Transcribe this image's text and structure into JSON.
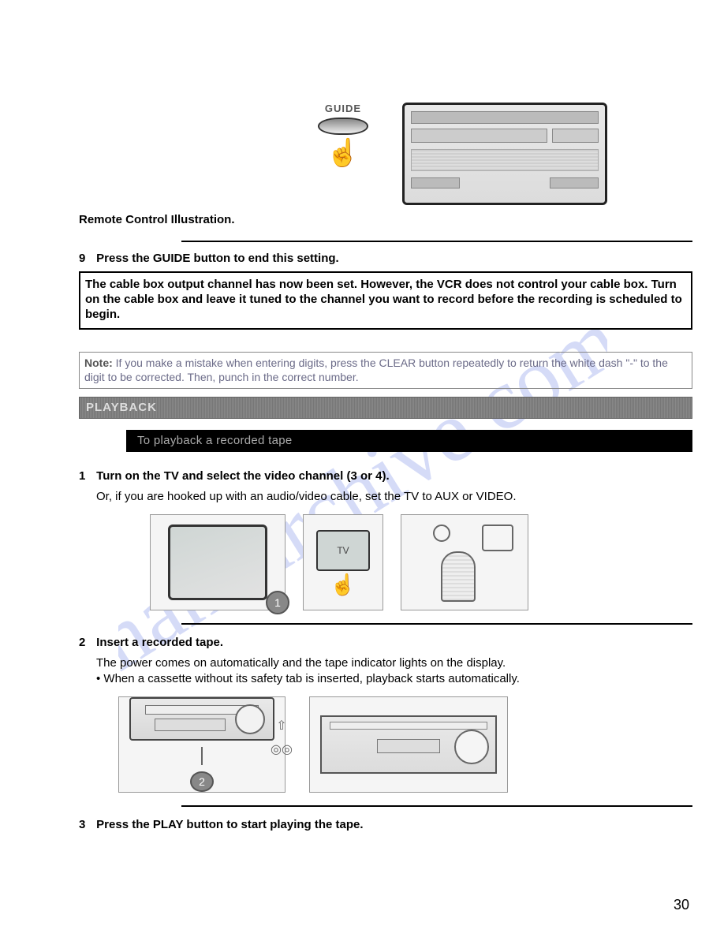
{
  "hero": {
    "guide_label": "GUIDE"
  },
  "captions": {
    "remote": "Remote Control Illustration."
  },
  "steps": {
    "s9": {
      "num": "9",
      "text": "Press the GUIDE button to end this setting."
    },
    "s1": {
      "num": "1",
      "text": "Turn on the TV and select the video channel (3 or 4).",
      "body": "Or, if you are hooked up with an audio/video cable, set the TV to AUX or VIDEO."
    },
    "s2": {
      "num": "2",
      "text": "Insert a recorded tape.",
      "body1": "The power comes on automatically and the tape indicator lights on the display.",
      "body2": "• When a cassette without its safety tab is inserted, playback starts automatically."
    },
    "s3": {
      "num": "3",
      "text": "Press the PLAY button to start playing the tape."
    }
  },
  "boxes": {
    "cable": "The cable box output channel has now been set. However, the VCR does not control your cable box. Turn on the cable box and leave it tuned to the channel you want to record before the recording is scheduled to begin.",
    "note_label": "Note: ",
    "note_text": "If you make a mistake when entering digits, press the CLEAR button repeatedly to return the white dash \"-\" to the digit to be corrected. Then, punch in the correct number."
  },
  "sections": {
    "playback": "PLAYBACK",
    "playback_sub": "To playback a recorded tape"
  },
  "illus": {
    "c1": "1",
    "c2": "2",
    "tv_label": "TV"
  },
  "page_number": "30"
}
